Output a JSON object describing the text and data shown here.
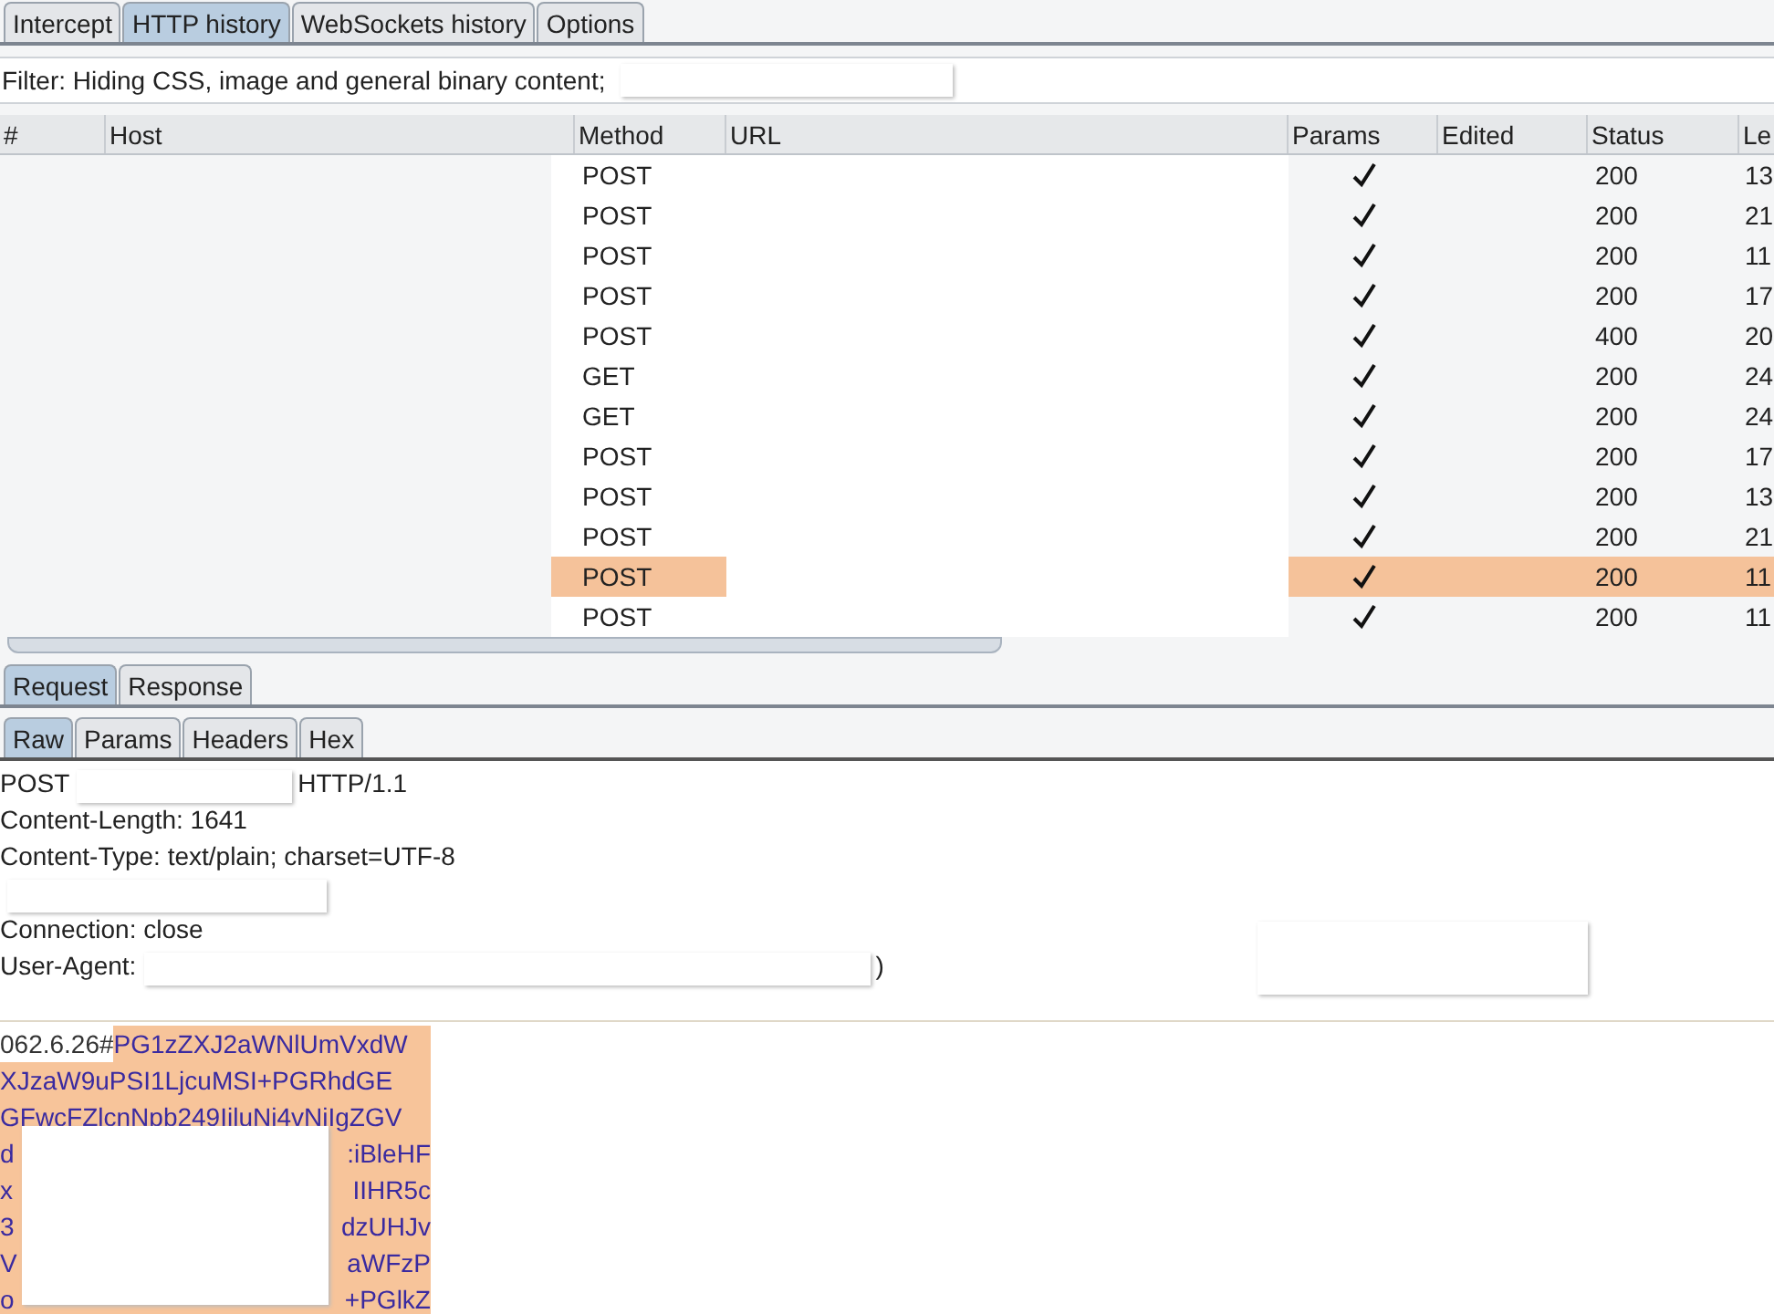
{
  "tabs": [
    {
      "label": "Intercept",
      "selected": false
    },
    {
      "label": "HTTP history",
      "selected": true
    },
    {
      "label": "WebSockets history",
      "selected": false
    },
    {
      "label": "Options",
      "selected": false
    }
  ],
  "filter": {
    "text": "Filter: Hiding CSS, image and general binary content;"
  },
  "table": {
    "columns": [
      "#",
      "Host",
      "Method",
      "URL",
      "Params",
      "Edited",
      "Status",
      "Le"
    ],
    "rows": [
      {
        "method": "POST",
        "params": true,
        "status": "200",
        "column_8": "13",
        "selected": false
      },
      {
        "method": "POST",
        "params": true,
        "status": "200",
        "column_8": "21",
        "selected": false
      },
      {
        "method": "POST",
        "params": true,
        "status": "200",
        "column_8": "11",
        "selected": false
      },
      {
        "method": "POST",
        "params": true,
        "status": "200",
        "column_8": "17",
        "selected": false
      },
      {
        "method": "POST",
        "params": true,
        "status": "400",
        "column_8": "20",
        "selected": false
      },
      {
        "method": "GET",
        "params": true,
        "status": "200",
        "column_8": "24",
        "selected": false
      },
      {
        "method": "GET",
        "params": true,
        "status": "200",
        "column_8": "24",
        "selected": false
      },
      {
        "method": "POST",
        "params": true,
        "status": "200",
        "column_8": "17",
        "selected": false
      },
      {
        "method": "POST",
        "params": true,
        "status": "200",
        "column_8": "13",
        "selected": false
      },
      {
        "method": "POST",
        "params": true,
        "status": "200",
        "column_8": "21",
        "selected": false
      },
      {
        "method": "POST",
        "params": true,
        "status": "200",
        "column_8": "11",
        "selected": true
      },
      {
        "method": "POST",
        "params": true,
        "status": "200",
        "column_8": "11",
        "selected": false
      }
    ]
  },
  "message_tabs": [
    {
      "label": "Request",
      "selected": true
    },
    {
      "label": "Response",
      "selected": false
    }
  ],
  "view_tabs": [
    {
      "label": "Raw",
      "selected": true
    },
    {
      "label": "Params",
      "selected": false
    },
    {
      "label": "Headers",
      "selected": false
    },
    {
      "label": "Hex",
      "selected": false
    }
  ],
  "headers": [
    {
      "start": "POST",
      "end": "HTTP/1.1",
      "redacted": true
    },
    {
      "start": "Content-Length: 1641",
      "redacted": false
    },
    {
      "start": "Content-Type: text/plain; charset=UTF-8",
      "redacted": false
    },
    {
      "redacted": true
    },
    {
      "start": "Connection: close",
      "redacted": false
    },
    {
      "start": "User-Agent:",
      "end": ")",
      "redacted": true
    }
  ],
  "body": [
    {
      "plain": "062.6.26#",
      "start": "PG1zZXJ2aWNlUmVxdW"
    },
    {
      "start": "XJzaW9uPSI1LjcuMSI+PGRhdGE"
    },
    {
      "start": "GFwcFZlcnNpb249IiluNi4vNiIgZGV"
    },
    {
      "start": "d",
      "end": ":iBleHF"
    },
    {
      "start": "x",
      "end": "IIHR5c"
    },
    {
      "start": "3",
      "end": "dzUHJv"
    },
    {
      "start": "V",
      "end": "aWFzP"
    },
    {
      "start": "o",
      "end": "+PGlkZ"
    }
  ]
}
